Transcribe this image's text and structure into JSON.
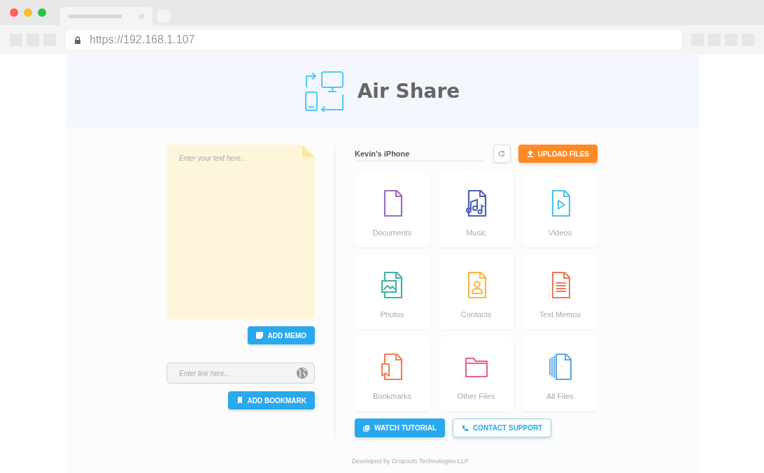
{
  "browser": {
    "url": "https://192.168.1.107"
  },
  "app": {
    "title": "Air Share"
  },
  "memo": {
    "placeholder": "Enter your text here...",
    "button": "ADD MEMO"
  },
  "link": {
    "placeholder": "Enter link here...",
    "button": "ADD BOOKMARK"
  },
  "device": {
    "name": "Kevin's iPhone",
    "upload": "UPLOAD FILES"
  },
  "categories": [
    {
      "kind": "document",
      "label": "Documents",
      "color": "#9b6bbf"
    },
    {
      "kind": "music",
      "label": "Music",
      "color": "#4a5fb5"
    },
    {
      "kind": "video",
      "label": "Videos",
      "color": "#4cc3f0"
    },
    {
      "kind": "photo",
      "label": "Photos",
      "color": "#3fb2a8"
    },
    {
      "kind": "contact",
      "label": "Contacts",
      "color": "#f5b942"
    },
    {
      "kind": "memo",
      "label": "Text Memos",
      "color": "#ef7a56"
    },
    {
      "kind": "bookmark",
      "label": "Bookmarks",
      "color": "#ef7f56"
    },
    {
      "kind": "folder",
      "label": "Other Files",
      "color": "#e8638a"
    },
    {
      "kind": "all",
      "label": "All Files",
      "color": "#5aa9e6"
    }
  ],
  "actions": [
    {
      "kind": "primary",
      "label": "WATCH TUTORIAL"
    },
    {
      "kind": "outline",
      "label": "CONTACT SUPPORT"
    }
  ],
  "footer": "Developed by Dropouts Technologies LLP"
}
